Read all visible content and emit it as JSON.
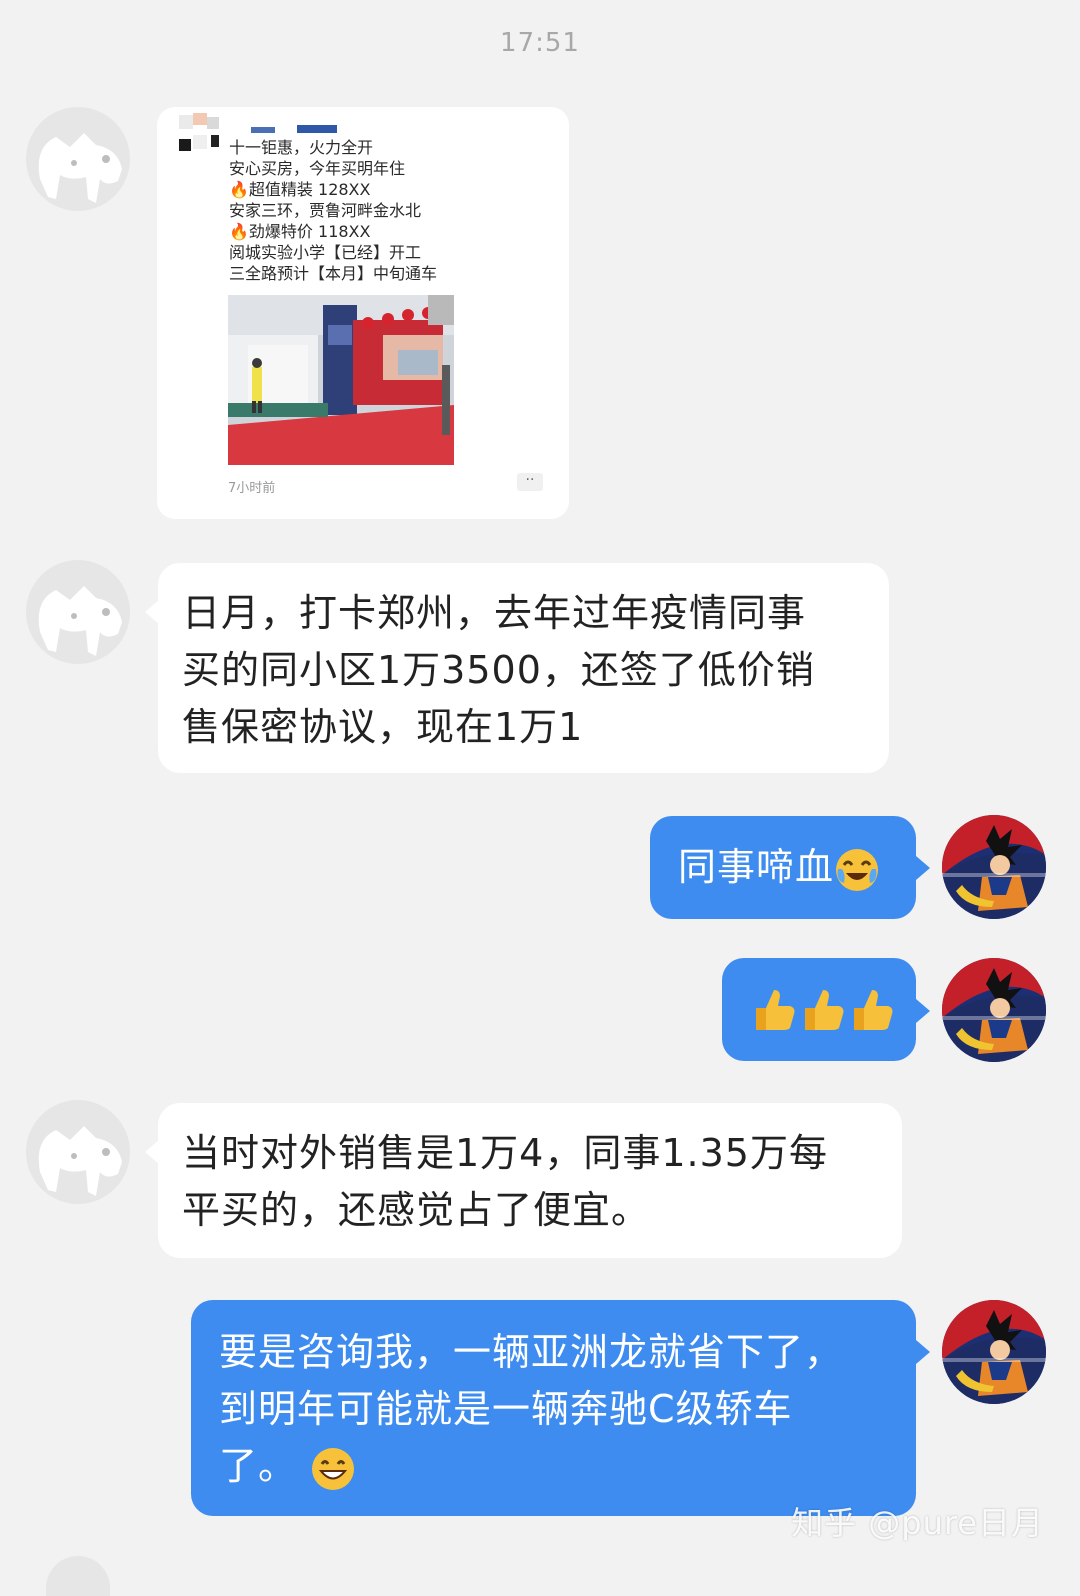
{
  "chat": {
    "timestamp": "17:51",
    "shared_card": {
      "lines": [
        "十一钜惠，火力全开",
        "安心买房，今年买明年住",
        "🔥超值精装 128XX",
        "安家三环，贾鲁河畔金水北",
        "🔥劲爆特价 118XX",
        "阅城实验小学【已经】开工",
        "三全路预计【本月】中旬通车"
      ],
      "time": "7小时前",
      "more": "··"
    },
    "messages": [
      {
        "side": "in",
        "lines": [
          "日月，打卡郑州，去年过年疫情同事",
          "买的同小区1万3500，还签了低价销",
          "售保密协议，现在1万1"
        ]
      },
      {
        "side": "out",
        "text": "同事啼血",
        "emoji": "crying-laughing-icon"
      },
      {
        "side": "out",
        "emoji": "thumbs-up-icon x3"
      },
      {
        "side": "in",
        "lines": [
          "当时对外销售是1万4，同事1.35万每",
          "平买的，还感觉占了便宜。"
        ]
      },
      {
        "side": "out",
        "lines": [
          "要是咨询我，一辆亚洲龙就省下了，",
          "到明年可能就是一辆奔驰C级轿车",
          "了。"
        ],
        "emoji": "grinning-face-icon"
      }
    ],
    "watermark": "知乎 @pure日月"
  },
  "colors": {
    "background": "#f2f2f2",
    "incoming_bubble": "#ffffff",
    "outgoing_bubble": "#3e8cf0",
    "timestamp": "#a8a8a8"
  }
}
